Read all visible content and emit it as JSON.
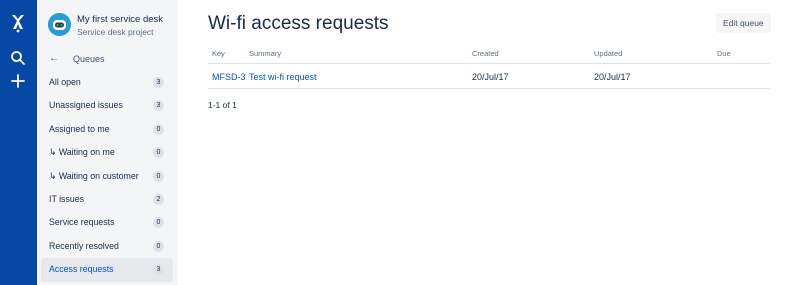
{
  "global_nav": {
    "logo_icon": "atlassian-service-desk-logo-icon",
    "search_icon": "search-icon",
    "create_icon": "plus-icon"
  },
  "sidebar": {
    "project_name": "My first service desk",
    "project_type": "Service desk project",
    "queues_label": "Queues",
    "back_icon": "←",
    "items": [
      {
        "label": "All open",
        "count": "3"
      },
      {
        "label": "Unassigned issues",
        "count": "3"
      },
      {
        "label": "Assigned to me",
        "count": "0"
      },
      {
        "label": "↳ Waiting on me",
        "count": "0"
      },
      {
        "label": "↳ Waiting on customer",
        "count": "0"
      },
      {
        "label": "IT issues",
        "count": "2"
      },
      {
        "label": "Service requests",
        "count": "0"
      },
      {
        "label": "Recently resolved",
        "count": "0"
      },
      {
        "label": "Access requests",
        "count": "3",
        "active": true
      }
    ]
  },
  "main": {
    "title": "Wi-fi access requests",
    "edit_queue_label": "Edit queue",
    "table": {
      "columns": [
        "Key",
        "Summary",
        "Created",
        "Updated",
        "Due"
      ],
      "rows": [
        {
          "key": "MFSD-3",
          "summary": "Test wi-fi request",
          "created": "20/Jul/17",
          "updated": "20/Jul/17",
          "due": ""
        }
      ]
    },
    "pagination": "1-1 of 1"
  },
  "colors": {
    "nav_background": "#0747a6",
    "sidebar_background": "#f4f5f7",
    "link": "#0052cc",
    "text": "#172b4d"
  }
}
